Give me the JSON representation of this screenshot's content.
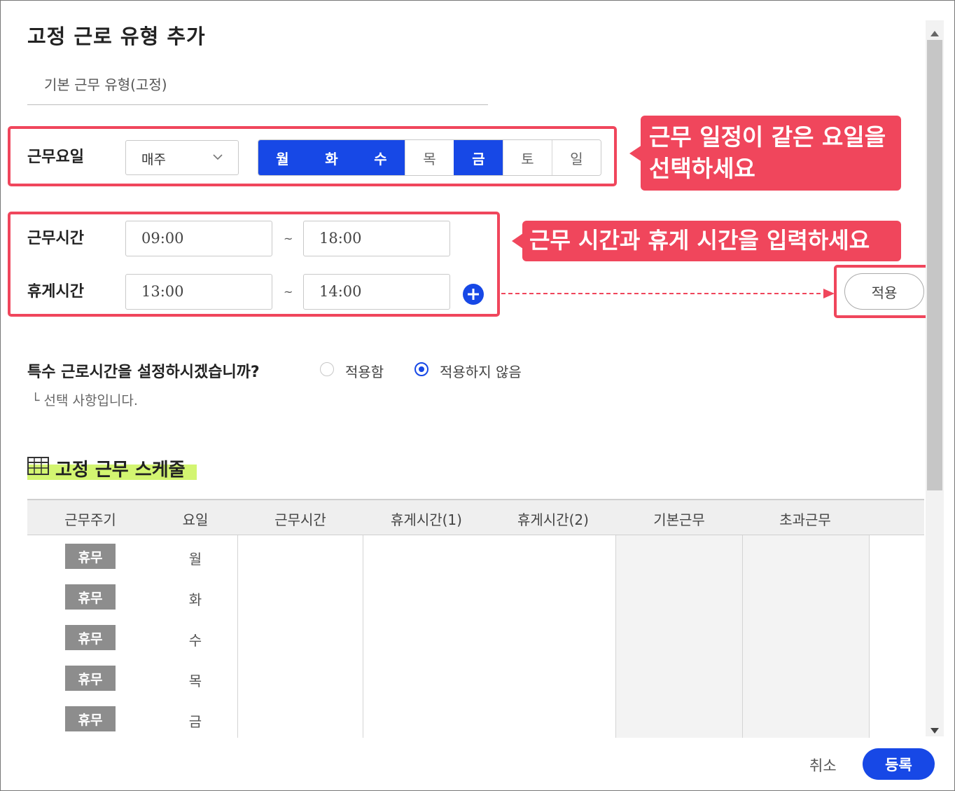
{
  "dialog": {
    "title": "고정 근로 유형 추가",
    "subtitle": "기본 근무 유형(고정)"
  },
  "workdays": {
    "label": "근무요일",
    "frequency_selected": "매주",
    "days": [
      {
        "label": "월",
        "selected": true
      },
      {
        "label": "화",
        "selected": true
      },
      {
        "label": "수",
        "selected": true
      },
      {
        "label": "목",
        "selected": false
      },
      {
        "label": "금",
        "selected": true
      },
      {
        "label": "토",
        "selected": false
      },
      {
        "label": "일",
        "selected": false
      }
    ]
  },
  "work_time": {
    "label": "근무시간",
    "start": "09:00",
    "end": "18:00",
    "separator": "~"
  },
  "break_time": {
    "label": "휴게시간",
    "start": "13:00",
    "end": "14:00",
    "separator": "~"
  },
  "apply_button": "적용",
  "callouts": {
    "days": "근무 일정이 같은 요일을\n선택하세요",
    "times": "근무 시간과 휴게 시간을 입력하세요"
  },
  "special_hours": {
    "question": "특수 근로시간을 설정하시겠습니까?",
    "options": [
      {
        "label": "적용함",
        "selected": false
      },
      {
        "label": "적용하지 않음",
        "selected": true
      }
    ],
    "note": "└ 선택 사항입니다."
  },
  "schedule": {
    "title": "고정 근무 스케줄",
    "columns": [
      "근무주기",
      "요일",
      "근무시간",
      "휴게시간(1)",
      "휴게시간(2)",
      "기본근무",
      "초과근무"
    ],
    "rows": [
      {
        "cycle": "휴무",
        "day": "월"
      },
      {
        "cycle": "휴무",
        "day": "화"
      },
      {
        "cycle": "휴무",
        "day": "수"
      },
      {
        "cycle": "휴무",
        "day": "목"
      },
      {
        "cycle": "휴무",
        "day": "금"
      }
    ]
  },
  "footer": {
    "cancel": "취소",
    "register": "등록"
  },
  "colors": {
    "accent": "#1748e6",
    "highlight": "#f0465c",
    "section_marker": "#d3f571",
    "rest_badge": "#8d8d8d"
  },
  "icons": [
    "chevron-down-icon",
    "plus-circle-icon",
    "table-grid-icon",
    "scroll-up-icon",
    "scroll-down-icon"
  ]
}
